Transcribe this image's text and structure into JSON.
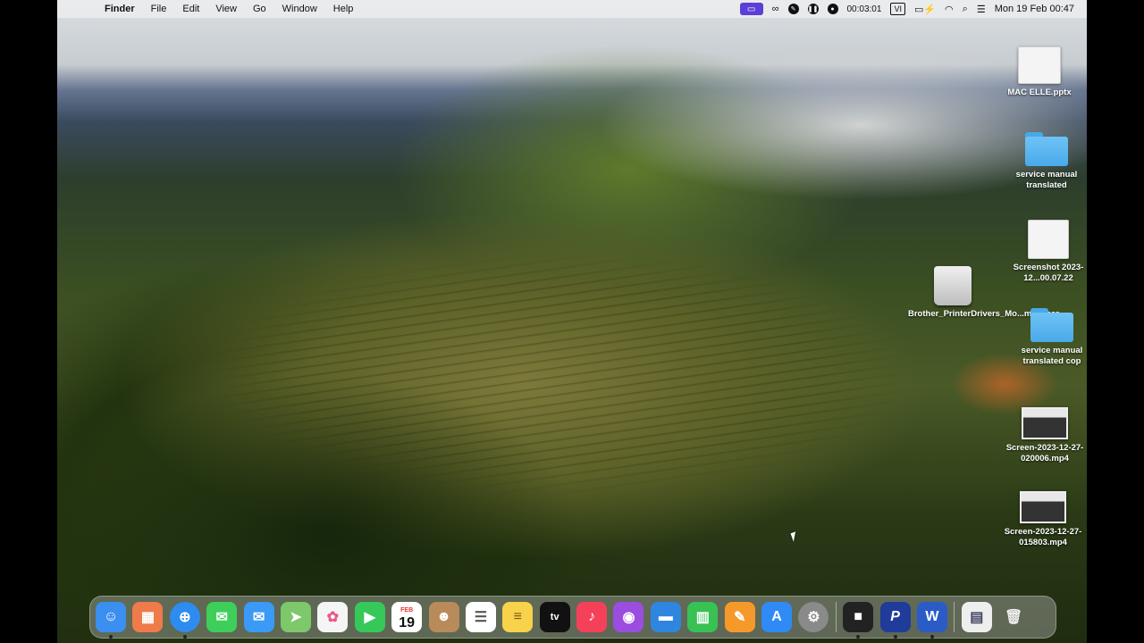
{
  "menubar": {
    "apple_symbol": "",
    "items": [
      "Finder",
      "File",
      "Edit",
      "View",
      "Go",
      "Window",
      "Help"
    ],
    "timer": "00:03:01",
    "input_source": "VI",
    "clock": "Mon 19 Feb  00:47"
  },
  "desktop": {
    "icons": [
      {
        "label": "MAC ELLE.pptx",
        "kind": "doc"
      },
      {
        "label": "service manual translated",
        "kind": "folder"
      },
      {
        "label": "Screenshot 2023-12...00.07.22",
        "kind": "doc"
      },
      {
        "label": "Brother_PrinterDrivers_Mo...meLaser",
        "kind": "disk"
      },
      {
        "label": "service manual translated cop",
        "kind": "folder"
      },
      {
        "label": "Screen-2023-12-27-020006.mp4",
        "kind": "video"
      },
      {
        "label": "Screen-2023-12-27-015803.mp4",
        "kind": "video"
      }
    ]
  },
  "dock": {
    "calendar_month": "FEB",
    "calendar_day": "19",
    "appletv_label": "tv",
    "items": [
      {
        "name": "finder",
        "color": "#3b8ff0",
        "glyph": "☺",
        "running": true
      },
      {
        "name": "launchpad",
        "color": "#ef7a4a",
        "glyph": "▦",
        "running": false
      },
      {
        "name": "safari",
        "color": "#2e8bf0",
        "glyph": "⊕",
        "running": true
      },
      {
        "name": "messages",
        "color": "#3ecf5a",
        "glyph": "✉",
        "running": false
      },
      {
        "name": "mail",
        "color": "#3a9af5",
        "glyph": "✉",
        "running": false
      },
      {
        "name": "maps",
        "color": "#7cc86a",
        "glyph": "➤",
        "running": false
      },
      {
        "name": "photos",
        "color": "#f5f5f5",
        "glyph": "✿",
        "running": false
      },
      {
        "name": "facetime",
        "color": "#37c85a",
        "glyph": "▶",
        "running": false
      },
      {
        "name": "calendar",
        "color": "#ffffff",
        "glyph": "",
        "running": false
      },
      {
        "name": "contacts",
        "color": "#b98a5a",
        "glyph": "☻",
        "running": false
      },
      {
        "name": "reminders",
        "color": "#ffffff",
        "glyph": "☰",
        "running": false
      },
      {
        "name": "notes",
        "color": "#f7d24a",
        "glyph": "≡",
        "running": false
      },
      {
        "name": "appletv",
        "color": "#111111",
        "glyph": "",
        "running": false
      },
      {
        "name": "music",
        "color": "#f5405a",
        "glyph": "♪",
        "running": false
      },
      {
        "name": "podcasts",
        "color": "#9b4de0",
        "glyph": "◉",
        "running": false
      },
      {
        "name": "keynote",
        "color": "#2f86e0",
        "glyph": "▬",
        "running": false
      },
      {
        "name": "numbers",
        "color": "#38c254",
        "glyph": "▥",
        "running": false
      },
      {
        "name": "pages",
        "color": "#f59a2a",
        "glyph": "✎",
        "running": false
      },
      {
        "name": "appstore",
        "color": "#2f8af5",
        "glyph": "A",
        "running": false
      },
      {
        "name": "system-settings",
        "color": "#8a8a8a",
        "glyph": "⚙",
        "running": false
      },
      {
        "name": "screen-recorder",
        "color": "#222222",
        "glyph": "■",
        "running": true
      },
      {
        "name": "pen-app",
        "color": "#1f3c9a",
        "glyph": "P",
        "running": true
      },
      {
        "name": "word",
        "color": "#2b5cc6",
        "glyph": "W",
        "running": true
      },
      {
        "name": "preview-document",
        "color": "#eeeeee",
        "glyph": "▤",
        "running": false
      },
      {
        "name": "trash",
        "color": "#d8d8d8",
        "glyph": "🗑",
        "running": false
      }
    ]
  }
}
